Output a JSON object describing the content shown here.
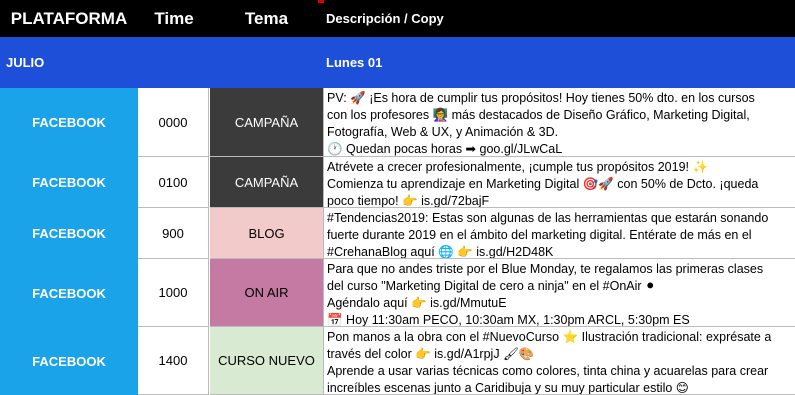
{
  "header": {
    "plataforma": "PLATAFORMA",
    "time": "Time",
    "tema": "Tema",
    "descripcion": "Descripción / Copy"
  },
  "month_row": {
    "month": "JULIO",
    "day": "Lunes 01"
  },
  "rows": [
    {
      "plataforma": "FACEBOOK",
      "time": "0000",
      "tema": "CAMPAÑA",
      "lines": [
        "PV: 🚀 ¡Es hora de cumplir tus propósitos! Hoy tienes 50% dto. en los cursos",
        "con los profesores 👩‍🏫 más destacados de Diseño Gráfico, Marketing Digital,",
        "Fotografía, Web & UX, y Animación & 3D.",
        "🕐 Quedan pocas horas ➡ goo.gl/JLwCaL"
      ]
    },
    {
      "plataforma": "FACEBOOK",
      "time": "0100",
      "tema": "CAMPAÑA",
      "lines": [
        "Atrévete a crecer profesionalmente, ¡cumple tus propósitos 2019! ✨",
        "Comienza tu aprendizaje en Marketing Digital 🎯🚀 con 50% de Dcto. ¡queda",
        "poco tiempo! 👉 is.gd/72bajF"
      ]
    },
    {
      "plataforma": "FACEBOOK",
      "time": "900",
      "tema": "BLOG",
      "lines": [
        "#Tendencias2019: Estas son algunas de las herramientas que estarán sonando",
        "fuerte durante 2019 en el ámbito del marketing digital. Entérate de más en el",
        "#CrehanaBlog aquí 🌐 👉 is.gd/H2D48K"
      ]
    },
    {
      "plataforma": "FACEBOOK",
      "time": "1000",
      "tema": "ON AIR",
      "lines": [
        "Para que no andes triste por el Blue Monday, te regalamos las primeras clases",
        "del curso \"Marketing Digital de cero a ninja\" en el #OnAir ⚫",
        "Agéndalo aquí 👉 is.gd/MmutuE",
        "📅 Hoy 11:30am PECO, 10:30am MX, 1:30pm ARCL, 5:30pm ES"
      ]
    },
    {
      "plataforma": "FACEBOOK",
      "time": "1400",
      "tema": "CURSO NUEVO",
      "lines": [
        "Pon manos a la obra con el #NuevoCurso ⭐ Ilustración tradicional: exprésate a",
        "través del color 👉 is.gd/A1rpjJ 🖌🎨",
        "Aprende a usar varias técnicas como colores, tinta china y acuarelas para crear",
        "increíbles escenas junto a Caridibuja y su muy particular estilo 😊"
      ]
    }
  ]
}
